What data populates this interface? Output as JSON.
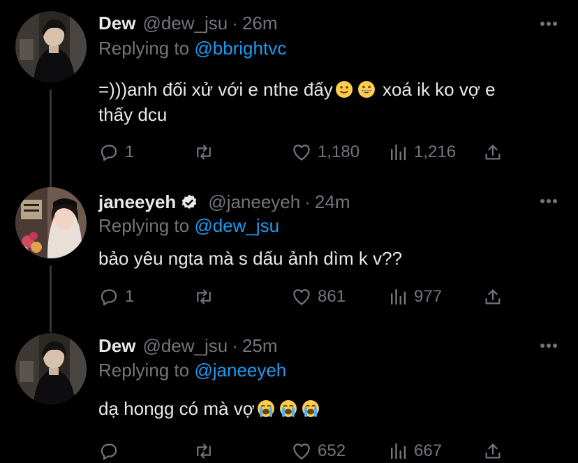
{
  "tweets": [
    {
      "name": "Dew",
      "handle": "@dew_jsu",
      "separator": "·",
      "time": "26m",
      "replying_prefix": "Replying to",
      "replying_to": "@bbrightvc",
      "text_a": "=)))anh đối xử với e nthe đấy",
      "text_b": "xoá ik ko vợ e",
      "text_c": "thấy dcu",
      "replies": "1",
      "retweets": "",
      "likes": "1,180",
      "views": "1,216"
    },
    {
      "name": "janeeyeh",
      "handle": "@janeeyeh",
      "separator": "·",
      "time": "24m",
      "replying_prefix": "Replying to",
      "replying_to": "@dew_jsu",
      "text_a": "bảo yêu ngta mà s dấu ảnh dìm k v??",
      "replies": "1",
      "retweets": "",
      "likes": "861",
      "views": "977"
    },
    {
      "name": "Dew",
      "handle": "@dew_jsu",
      "separator": "·",
      "time": "25m",
      "replying_prefix": "Replying to",
      "replying_to": "@janeeyeh",
      "text_a": "dạ hongg có mà vợ",
      "replies": "",
      "retweets": "",
      "likes": "652",
      "views": "667"
    }
  ],
  "icons": {
    "reply": "speech-bubble-icon",
    "retweet": "retweet-icon",
    "like": "heart-icon",
    "views": "bar-chart-icon",
    "share": "share-icon",
    "more": "more-dots-icon",
    "verified": "verified-badge-icon"
  },
  "colors": {
    "background": "#000000",
    "text": "#e7e9ea",
    "muted": "#71767b",
    "link": "#1d9bf0",
    "thread_line": "#333639"
  }
}
